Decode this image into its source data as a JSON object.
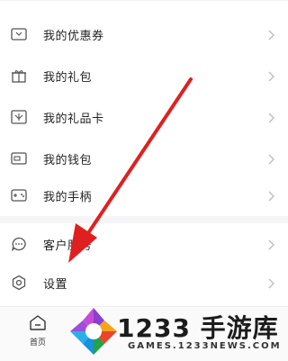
{
  "menu": {
    "items": [
      {
        "label": "我的优惠券",
        "icon": "coupon-icon"
      },
      {
        "label": "我的礼包",
        "icon": "gift-box-icon"
      },
      {
        "label": "我的礼品卡",
        "icon": "gift-card-icon"
      },
      {
        "label": "我的钱包",
        "icon": "wallet-icon"
      },
      {
        "label": "我的手柄",
        "icon": "gamepad-icon"
      }
    ],
    "support_items": [
      {
        "label": "客户服务",
        "icon": "chat-bubble-icon"
      },
      {
        "label": "设置",
        "icon": "settings-gear-icon"
      }
    ]
  },
  "bottom_nav": {
    "home_label": "首页"
  },
  "watermark": {
    "brand": "1233 手游库",
    "url": "GAMES.1233NEWS.COM"
  },
  "annotation": {
    "arrow_color": "#e02020"
  }
}
